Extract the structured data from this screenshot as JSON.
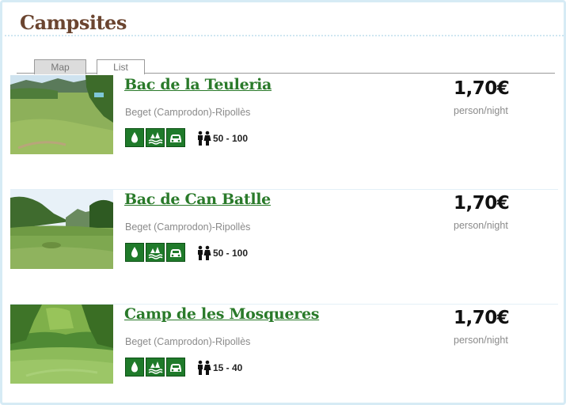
{
  "header": {
    "title": "Campsites"
  },
  "tabs": [
    {
      "label": "Map",
      "active": false
    },
    {
      "label": "List",
      "active": true
    }
  ],
  "colors": {
    "accent_green": "#1f7a2a",
    "title_brown": "#6b4530"
  },
  "campsites": [
    {
      "name": "Bac de la Teuleria",
      "location": "Beget (Camprodon)-Ripollès",
      "amenities": [
        "water-drop-icon",
        "river-icon",
        "car-icon"
      ],
      "capacity": "50 - 100",
      "price": "1,70€",
      "unit": "person/night",
      "photo": "meadow-with-tent"
    },
    {
      "name": "Bac de Can Batlle",
      "location": "Beget (Camprodon)-Ripollès",
      "amenities": [
        "water-drop-icon",
        "river-icon",
        "car-icon"
      ],
      "capacity": "50 - 100",
      "price": "1,70€",
      "unit": "person/night",
      "photo": "meadow-with-hills"
    },
    {
      "name": "Camp de les Mosqueres",
      "location": "Beget (Camprodon)-Ripollès",
      "amenities": [
        "water-drop-icon",
        "river-icon",
        "car-icon"
      ],
      "capacity": "15 - 40",
      "price": "1,70€",
      "unit": "person/night",
      "photo": "forest-clearing"
    }
  ]
}
